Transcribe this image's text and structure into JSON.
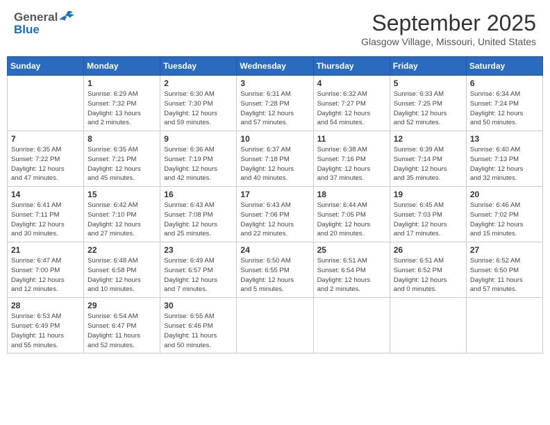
{
  "header": {
    "logo_general": "General",
    "logo_blue": "Blue",
    "month": "September 2025",
    "location": "Glasgow Village, Missouri, United States"
  },
  "weekdays": [
    "Sunday",
    "Monday",
    "Tuesday",
    "Wednesday",
    "Thursday",
    "Friday",
    "Saturday"
  ],
  "weeks": [
    [
      {
        "day": "",
        "info": ""
      },
      {
        "day": "1",
        "info": "Sunrise: 6:29 AM\nSunset: 7:32 PM\nDaylight: 13 hours\nand 2 minutes."
      },
      {
        "day": "2",
        "info": "Sunrise: 6:30 AM\nSunset: 7:30 PM\nDaylight: 12 hours\nand 59 minutes."
      },
      {
        "day": "3",
        "info": "Sunrise: 6:31 AM\nSunset: 7:28 PM\nDaylight: 12 hours\nand 57 minutes."
      },
      {
        "day": "4",
        "info": "Sunrise: 6:32 AM\nSunset: 7:27 PM\nDaylight: 12 hours\nand 54 minutes."
      },
      {
        "day": "5",
        "info": "Sunrise: 6:33 AM\nSunset: 7:25 PM\nDaylight: 12 hours\nand 52 minutes."
      },
      {
        "day": "6",
        "info": "Sunrise: 6:34 AM\nSunset: 7:24 PM\nDaylight: 12 hours\nand 50 minutes."
      }
    ],
    [
      {
        "day": "7",
        "info": "Sunrise: 6:35 AM\nSunset: 7:22 PM\nDaylight: 12 hours\nand 47 minutes."
      },
      {
        "day": "8",
        "info": "Sunrise: 6:35 AM\nSunset: 7:21 PM\nDaylight: 12 hours\nand 45 minutes."
      },
      {
        "day": "9",
        "info": "Sunrise: 6:36 AM\nSunset: 7:19 PM\nDaylight: 12 hours\nand 42 minutes."
      },
      {
        "day": "10",
        "info": "Sunrise: 6:37 AM\nSunset: 7:18 PM\nDaylight: 12 hours\nand 40 minutes."
      },
      {
        "day": "11",
        "info": "Sunrise: 6:38 AM\nSunset: 7:16 PM\nDaylight: 12 hours\nand 37 minutes."
      },
      {
        "day": "12",
        "info": "Sunrise: 6:39 AM\nSunset: 7:14 PM\nDaylight: 12 hours\nand 35 minutes."
      },
      {
        "day": "13",
        "info": "Sunrise: 6:40 AM\nSunset: 7:13 PM\nDaylight: 12 hours\nand 32 minutes."
      }
    ],
    [
      {
        "day": "14",
        "info": "Sunrise: 6:41 AM\nSunset: 7:11 PM\nDaylight: 12 hours\nand 30 minutes."
      },
      {
        "day": "15",
        "info": "Sunrise: 6:42 AM\nSunset: 7:10 PM\nDaylight: 12 hours\nand 27 minutes."
      },
      {
        "day": "16",
        "info": "Sunrise: 6:43 AM\nSunset: 7:08 PM\nDaylight: 12 hours\nand 25 minutes."
      },
      {
        "day": "17",
        "info": "Sunrise: 6:43 AM\nSunset: 7:06 PM\nDaylight: 12 hours\nand 22 minutes."
      },
      {
        "day": "18",
        "info": "Sunrise: 6:44 AM\nSunset: 7:05 PM\nDaylight: 12 hours\nand 20 minutes."
      },
      {
        "day": "19",
        "info": "Sunrise: 6:45 AM\nSunset: 7:03 PM\nDaylight: 12 hours\nand 17 minutes."
      },
      {
        "day": "20",
        "info": "Sunrise: 6:46 AM\nSunset: 7:02 PM\nDaylight: 12 hours\nand 15 minutes."
      }
    ],
    [
      {
        "day": "21",
        "info": "Sunrise: 6:47 AM\nSunset: 7:00 PM\nDaylight: 12 hours\nand 12 minutes."
      },
      {
        "day": "22",
        "info": "Sunrise: 6:48 AM\nSunset: 6:58 PM\nDaylight: 12 hours\nand 10 minutes."
      },
      {
        "day": "23",
        "info": "Sunrise: 6:49 AM\nSunset: 6:57 PM\nDaylight: 12 hours\nand 7 minutes."
      },
      {
        "day": "24",
        "info": "Sunrise: 6:50 AM\nSunset: 6:55 PM\nDaylight: 12 hours\nand 5 minutes."
      },
      {
        "day": "25",
        "info": "Sunrise: 6:51 AM\nSunset: 6:54 PM\nDaylight: 12 hours\nand 2 minutes."
      },
      {
        "day": "26",
        "info": "Sunrise: 6:51 AM\nSunset: 6:52 PM\nDaylight: 12 hours\nand 0 minutes."
      },
      {
        "day": "27",
        "info": "Sunrise: 6:52 AM\nSunset: 6:50 PM\nDaylight: 11 hours\nand 57 minutes."
      }
    ],
    [
      {
        "day": "28",
        "info": "Sunrise: 6:53 AM\nSunset: 6:49 PM\nDaylight: 11 hours\nand 55 minutes."
      },
      {
        "day": "29",
        "info": "Sunrise: 6:54 AM\nSunset: 6:47 PM\nDaylight: 11 hours\nand 52 minutes."
      },
      {
        "day": "30",
        "info": "Sunrise: 6:55 AM\nSunset: 6:46 PM\nDaylight: 11 hours\nand 50 minutes."
      },
      {
        "day": "",
        "info": ""
      },
      {
        "day": "",
        "info": ""
      },
      {
        "day": "",
        "info": ""
      },
      {
        "day": "",
        "info": ""
      }
    ]
  ]
}
